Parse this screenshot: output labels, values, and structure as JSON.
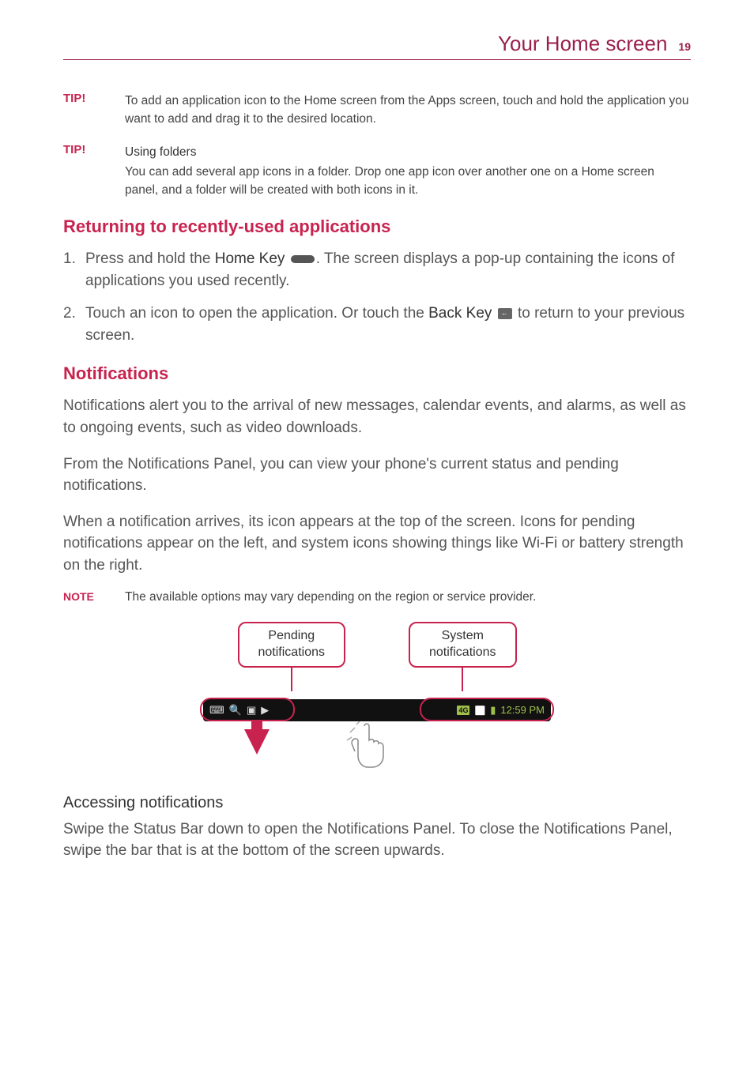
{
  "header": {
    "title": "Your Home screen",
    "page": "19"
  },
  "tips": [
    {
      "label": "TIP!",
      "subhead": "",
      "text": "To add an application icon to the Home screen from the Apps screen, touch and hold the application you want to add and drag it to the desired location."
    },
    {
      "label": "TIP!",
      "subhead": "Using folders",
      "text": "You can add several app icons in a folder. Drop one app icon over another one on a Home screen panel, and a folder will be created with both icons in it."
    }
  ],
  "sections": {
    "returning": {
      "heading": "Returning to recently-used applications",
      "step1_a": "Press and hold the ",
      "step1_key": "Home Key",
      "step1_b": ". The screen displays a pop-up containing the icons of applications you used recently.",
      "step2_a": "Touch an icon to open the application. Or touch the ",
      "step2_key": "Back Key",
      "step2_b": " to return to your previous screen."
    },
    "notifications": {
      "heading": "Notifications",
      "p1": "Notifications alert you to the arrival of new messages, calendar events, and alarms, as well as to ongoing events, such as video downloads.",
      "p2": "From the Notifications Panel, you can view your phone's current status and pending notifications.",
      "p3": "When a notification arrives, its icon appears at the top of the screen. Icons for pending notifications appear on the left, and system icons showing things like Wi-Fi or battery strength on the right."
    },
    "note": {
      "label": "NOTE",
      "text": "The available options may vary depending on the region or service provider."
    },
    "diagram": {
      "callout_left_l1": "Pending",
      "callout_left_l2": "notifications",
      "callout_right_l1": "System",
      "callout_right_l2": "notifications",
      "status_time": "12:59 PM",
      "status_4g": "4G"
    },
    "accessing": {
      "heading": "Accessing notifications",
      "p1": "Swipe the Status Bar down to open the Notifications Panel. To close the Notifications Panel, swipe the bar that is at the bottom of the screen upwards."
    }
  },
  "list_numbers": {
    "n1": "1.",
    "n2": "2."
  }
}
